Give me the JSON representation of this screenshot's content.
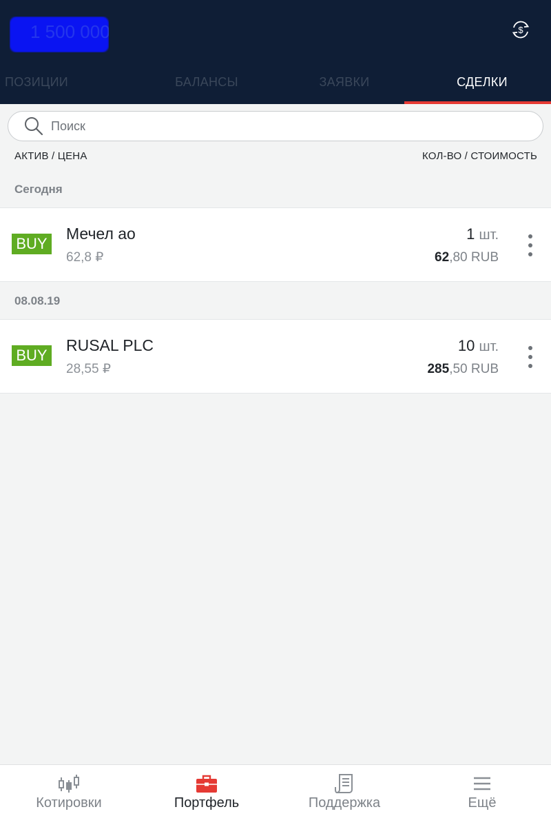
{
  "header": {
    "account_value": "1 500 000"
  },
  "tabs": [
    {
      "label": "ПОЗИЦИИ"
    },
    {
      "label": "БАЛАНСЫ"
    },
    {
      "label": "ЗАЯВКИ"
    },
    {
      "label": "СДЕЛКИ",
      "active": true
    }
  ],
  "search": {
    "placeholder": "Поиск"
  },
  "columns": {
    "left": "АКТИВ / ЦЕНА",
    "right": "КОЛ-ВО / СТОИМОСТЬ"
  },
  "sections": [
    {
      "label": "Сегодня",
      "trades": [
        {
          "side": "BUY",
          "name": "Мечел ао",
          "price": "62,8 ₽",
          "qty": "1",
          "qty_unit": "шт.",
          "cost_int": "62",
          "cost_frac": ",80 RUB"
        }
      ]
    },
    {
      "label": "08.08.19",
      "trades": [
        {
          "side": "BUY",
          "name": "RUSAL PLC",
          "price": "28,55 ₽",
          "qty": "10",
          "qty_unit": "шт.",
          "cost_int": "285",
          "cost_frac": ",50 RUB"
        }
      ]
    }
  ],
  "bottom_nav": [
    {
      "label": "Котировки",
      "icon": "candlestick-icon"
    },
    {
      "label": "Портфель",
      "icon": "briefcase-icon",
      "active": true
    },
    {
      "label": "Поддержка",
      "icon": "document-icon"
    },
    {
      "label": "Ещё",
      "icon": "menu-icon"
    }
  ],
  "colors": {
    "header_bg": "#0f1e36",
    "accent": "#e53a34",
    "buy": "#5fac22"
  }
}
